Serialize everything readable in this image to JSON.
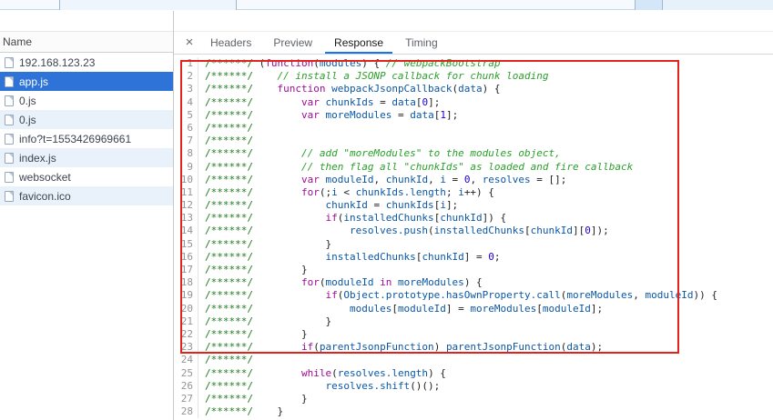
{
  "network_panel": {
    "header": "Name",
    "requests": [
      {
        "label": "192.168.123.23",
        "selected": false
      },
      {
        "label": "app.js",
        "selected": true
      },
      {
        "label": "0.js",
        "selected": false
      },
      {
        "label": "0.js",
        "selected": false
      },
      {
        "label": "info?t=1553426969661",
        "selected": false
      },
      {
        "label": "index.js",
        "selected": false
      },
      {
        "label": "websocket",
        "selected": false
      },
      {
        "label": "favicon.ico",
        "selected": false
      }
    ]
  },
  "detail_panel": {
    "close_label": "×",
    "tabs": [
      {
        "label": "Headers",
        "active": false
      },
      {
        "label": "Preview",
        "active": false
      },
      {
        "label": "Response",
        "active": true
      },
      {
        "label": "Timing",
        "active": false
      }
    ]
  },
  "colors": {
    "selection_blue": "#2e74d8",
    "row_stripe_blue": "#e9f1fb",
    "active_tab_underline": "#1a73e8",
    "annotation_red": "#e0241b",
    "comment_green": "#1f7a1f",
    "comment_green_bright": "#2aa02a",
    "keyword_magenta": "#9a0d91",
    "number_blue": "#1c00cf",
    "identifier_navy": "#0b57a5"
  },
  "code": {
    "language": "javascript",
    "lines": [
      [
        [
          "bc",
          "/******/ "
        ],
        [
          "p",
          "("
        ],
        [
          "k",
          "function"
        ],
        [
          "p",
          "("
        ],
        [
          "v",
          "modules"
        ],
        [
          "p",
          ") { "
        ],
        [
          "c",
          "// webpackBootstrap"
        ]
      ],
      [
        [
          "bc",
          "/******/"
        ],
        [
          "c",
          "    // install a JSONP callback for chunk loading"
        ]
      ],
      [
        [
          "bc",
          "/******/"
        ],
        [
          "p",
          "    "
        ],
        [
          "k",
          "function"
        ],
        [
          "v",
          " webpackJsonpCallback"
        ],
        [
          "p",
          "("
        ],
        [
          "v",
          "data"
        ],
        [
          "p",
          ") {"
        ]
      ],
      [
        [
          "bc",
          "/******/"
        ],
        [
          "p",
          "        "
        ],
        [
          "k",
          "var"
        ],
        [
          "v",
          " chunkIds"
        ],
        [
          "p",
          " = "
        ],
        [
          "v",
          "data"
        ],
        [
          "p",
          "["
        ],
        [
          "n",
          "0"
        ],
        [
          "p",
          "];"
        ]
      ],
      [
        [
          "bc",
          "/******/"
        ],
        [
          "p",
          "        "
        ],
        [
          "k",
          "var"
        ],
        [
          "v",
          " moreModules"
        ],
        [
          "p",
          " = "
        ],
        [
          "v",
          "data"
        ],
        [
          "p",
          "["
        ],
        [
          "n",
          "1"
        ],
        [
          "p",
          "];"
        ]
      ],
      [
        [
          "bc",
          "/******/"
        ]
      ],
      [
        [
          "bc",
          "/******/"
        ]
      ],
      [
        [
          "bc",
          "/******/"
        ],
        [
          "c",
          "        // add \"moreModules\" to the modules object,"
        ]
      ],
      [
        [
          "bc",
          "/******/"
        ],
        [
          "c",
          "        // then flag all \"chunkIds\" as loaded and fire callback"
        ]
      ],
      [
        [
          "bc",
          "/******/"
        ],
        [
          "p",
          "        "
        ],
        [
          "k",
          "var"
        ],
        [
          "v",
          " moduleId"
        ],
        [
          "p",
          ", "
        ],
        [
          "v",
          "chunkId"
        ],
        [
          "p",
          ", "
        ],
        [
          "v",
          "i"
        ],
        [
          "p",
          " = "
        ],
        [
          "n",
          "0"
        ],
        [
          "p",
          ", "
        ],
        [
          "v",
          "resolves"
        ],
        [
          "p",
          " = [];"
        ]
      ],
      [
        [
          "bc",
          "/******/"
        ],
        [
          "p",
          "        "
        ],
        [
          "k",
          "for"
        ],
        [
          "p",
          "(;"
        ],
        [
          "v",
          "i"
        ],
        [
          "p",
          " < "
        ],
        [
          "v",
          "chunkIds.length"
        ],
        [
          "p",
          "; "
        ],
        [
          "v",
          "i"
        ],
        [
          "p",
          "++) {"
        ]
      ],
      [
        [
          "bc",
          "/******/"
        ],
        [
          "p",
          "            "
        ],
        [
          "v",
          "chunkId"
        ],
        [
          "p",
          " = "
        ],
        [
          "v",
          "chunkIds"
        ],
        [
          "p",
          "["
        ],
        [
          "v",
          "i"
        ],
        [
          "p",
          "];"
        ]
      ],
      [
        [
          "bc",
          "/******/"
        ],
        [
          "p",
          "            "
        ],
        [
          "k",
          "if"
        ],
        [
          "p",
          "("
        ],
        [
          "v",
          "installedChunks"
        ],
        [
          "p",
          "["
        ],
        [
          "v",
          "chunkId"
        ],
        [
          "p",
          "]) {"
        ]
      ],
      [
        [
          "bc",
          "/******/"
        ],
        [
          "p",
          "                "
        ],
        [
          "v",
          "resolves.push"
        ],
        [
          "p",
          "("
        ],
        [
          "v",
          "installedChunks"
        ],
        [
          "p",
          "["
        ],
        [
          "v",
          "chunkId"
        ],
        [
          "p",
          "]["
        ],
        [
          "n",
          "0"
        ],
        [
          "p",
          "]);"
        ]
      ],
      [
        [
          "bc",
          "/******/"
        ],
        [
          "p",
          "            }"
        ]
      ],
      [
        [
          "bc",
          "/******/"
        ],
        [
          "p",
          "            "
        ],
        [
          "v",
          "installedChunks"
        ],
        [
          "p",
          "["
        ],
        [
          "v",
          "chunkId"
        ],
        [
          "p",
          "] = "
        ],
        [
          "n",
          "0"
        ],
        [
          "p",
          ";"
        ]
      ],
      [
        [
          "bc",
          "/******/"
        ],
        [
          "p",
          "        }"
        ]
      ],
      [
        [
          "bc",
          "/******/"
        ],
        [
          "p",
          "        "
        ],
        [
          "k",
          "for"
        ],
        [
          "p",
          "("
        ],
        [
          "v",
          "moduleId"
        ],
        [
          "p",
          " "
        ],
        [
          "k",
          "in"
        ],
        [
          "p",
          " "
        ],
        [
          "v",
          "moreModules"
        ],
        [
          "p",
          ") {"
        ]
      ],
      [
        [
          "bc",
          "/******/"
        ],
        [
          "p",
          "            "
        ],
        [
          "k",
          "if"
        ],
        [
          "p",
          "("
        ],
        [
          "v",
          "Object.prototype.hasOwnProperty.call"
        ],
        [
          "p",
          "("
        ],
        [
          "v",
          "moreModules"
        ],
        [
          "p",
          ", "
        ],
        [
          "v",
          "moduleId"
        ],
        [
          "p",
          ")) {"
        ]
      ],
      [
        [
          "bc",
          "/******/"
        ],
        [
          "p",
          "                "
        ],
        [
          "v",
          "modules"
        ],
        [
          "p",
          "["
        ],
        [
          "v",
          "moduleId"
        ],
        [
          "p",
          "] = "
        ],
        [
          "v",
          "moreModules"
        ],
        [
          "p",
          "["
        ],
        [
          "v",
          "moduleId"
        ],
        [
          "p",
          "];"
        ]
      ],
      [
        [
          "bc",
          "/******/"
        ],
        [
          "p",
          "            }"
        ]
      ],
      [
        [
          "bc",
          "/******/"
        ],
        [
          "p",
          "        }"
        ]
      ],
      [
        [
          "bc",
          "/******/"
        ],
        [
          "p",
          "        "
        ],
        [
          "k",
          "if"
        ],
        [
          "p",
          "("
        ],
        [
          "v",
          "parentJsonpFunction"
        ],
        [
          "p",
          ") "
        ],
        [
          "v",
          "parentJsonpFunction"
        ],
        [
          "p",
          "("
        ],
        [
          "v",
          "data"
        ],
        [
          "p",
          ");"
        ]
      ],
      [
        [
          "bc",
          "/******/"
        ]
      ],
      [
        [
          "bc",
          "/******/"
        ],
        [
          "p",
          "        "
        ],
        [
          "k",
          "while"
        ],
        [
          "p",
          "("
        ],
        [
          "v",
          "resolves.length"
        ],
        [
          "p",
          ") {"
        ]
      ],
      [
        [
          "bc",
          "/******/"
        ],
        [
          "p",
          "            "
        ],
        [
          "v",
          "resolves.shift"
        ],
        [
          "p",
          "()();"
        ]
      ],
      [
        [
          "bc",
          "/******/"
        ],
        [
          "p",
          "        }"
        ]
      ],
      [
        [
          "bc",
          "/******/"
        ],
        [
          "p",
          "    }"
        ]
      ]
    ]
  }
}
